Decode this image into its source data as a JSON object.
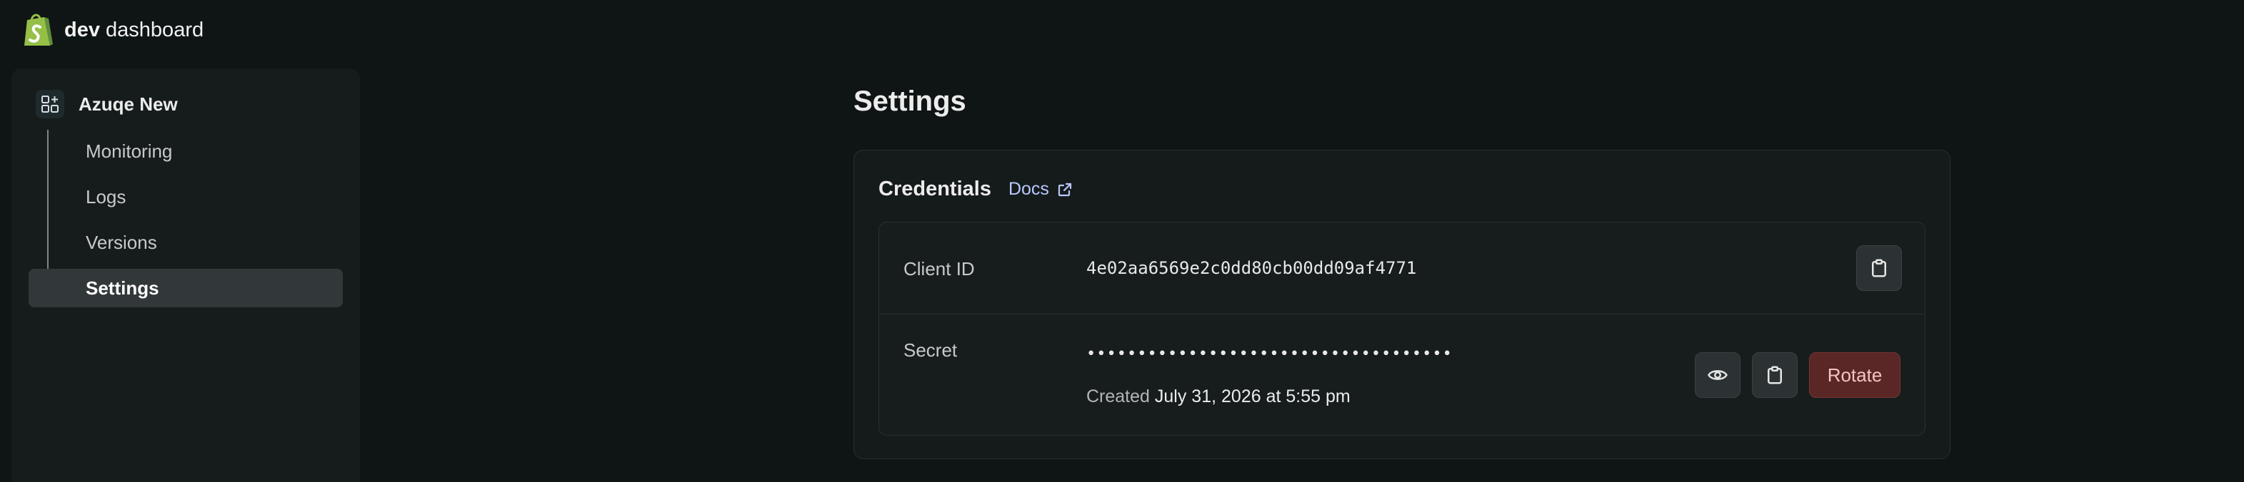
{
  "brand": {
    "bold": "dev",
    "rest": "dashboard"
  },
  "sidebar": {
    "app_name": "Azuqe New",
    "items": [
      {
        "label": "Monitoring"
      },
      {
        "label": "Logs"
      },
      {
        "label": "Versions"
      },
      {
        "label": "Settings",
        "active": true
      }
    ]
  },
  "page": {
    "title": "Settings"
  },
  "credentials": {
    "title": "Credentials",
    "docs_label": "Docs",
    "client_id": {
      "label": "Client ID",
      "value": "4e02aa6569e2c0dd80cb00dd09af4771"
    },
    "secret": {
      "label": "Secret",
      "masked_value": "••••••••••••••••••••••••••••••••••••",
      "created_prefix": "Created",
      "created_date": "July 31, 2026 at 5:55 pm",
      "rotate_label": "Rotate"
    }
  },
  "colors": {
    "brand_green": "#95bf47",
    "accent_link": "#b8c8ff",
    "danger_bg": "#5a2626",
    "danger_text": "#f2c4c4"
  }
}
